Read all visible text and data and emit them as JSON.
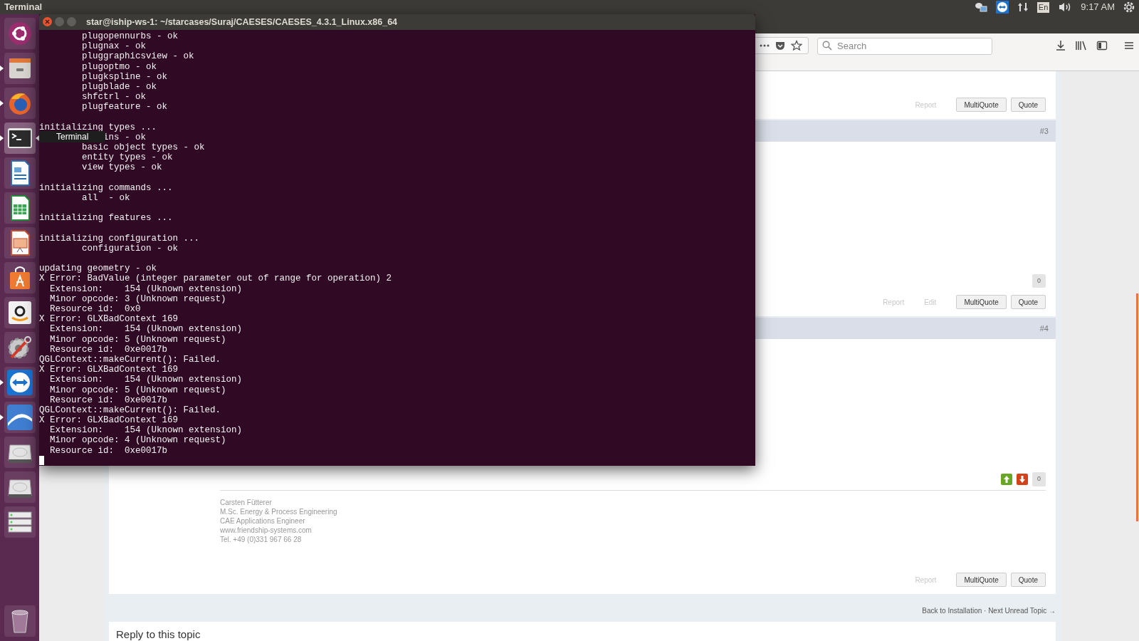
{
  "top_bar": {
    "app_name": "Terminal",
    "keyboard_layout": "En",
    "clock": "9:17 AM"
  },
  "launcher": {
    "items": [
      {
        "kind": "ubuntu",
        "running": false,
        "focused": false
      },
      {
        "kind": "files",
        "running": true,
        "focused": false
      },
      {
        "kind": "firefox",
        "running": true,
        "focused": false
      },
      {
        "kind": "terminal",
        "running": true,
        "focused": true
      },
      {
        "kind": "writer",
        "running": false,
        "focused": false
      },
      {
        "kind": "calc",
        "running": false,
        "focused": false
      },
      {
        "kind": "impress",
        "running": false,
        "focused": false
      },
      {
        "kind": "software",
        "running": false,
        "focused": false
      },
      {
        "kind": "amazon",
        "running": false,
        "focused": false
      },
      {
        "kind": "settings",
        "running": false,
        "focused": false
      },
      {
        "kind": "teamviewer",
        "running": true,
        "focused": false
      },
      {
        "kind": "arc",
        "running": true,
        "focused": false
      },
      {
        "kind": "drive",
        "running": false,
        "focused": false
      },
      {
        "kind": "drive",
        "running": false,
        "focused": false
      },
      {
        "kind": "server",
        "running": false,
        "focused": false
      },
      {
        "kind": "trash",
        "running": false,
        "focused": false
      }
    ],
    "tooltip": "Terminal"
  },
  "browser": {
    "search": {
      "placeholder": "Search"
    },
    "posts": [
      {
        "footer": {
          "actions": [
            "Report"
          ],
          "buttons": [
            "MultiQuote",
            "Quote"
          ]
        }
      },
      {
        "number": "#3",
        "reputation": "0",
        "footer": {
          "actions": [
            "Report",
            "Edit"
          ],
          "buttons": [
            "MultiQuote",
            "Quote"
          ]
        }
      },
      {
        "number": "#4",
        "reputation": "0",
        "votes": true,
        "signature": [
          "Carsten Fütterer",
          "M.Sc. Energy & Process Engineering",
          "CAE Applications Engineer",
          "www.friendship-systems.com",
          "Tel. +49 (0)331 967 66 28"
        ],
        "footer": {
          "actions": [
            "Report"
          ],
          "buttons": [
            "MultiQuote",
            "Quote"
          ]
        }
      }
    ],
    "topic_links": "Back to Installation · Next Unread Topic →",
    "reply_title": "Reply to this topic"
  },
  "terminal": {
    "title": "star@iship-ws-1: ~/starcases/Suraj/CAESES/CAESES_4.3.1_Linux.x86_64",
    "lines": [
      {
        "kind": "sub",
        "text": "plugopennurbs - ok"
      },
      {
        "kind": "sub",
        "text": "plugnax - ok"
      },
      {
        "kind": "sub",
        "text": "pluggraphicsview - ok"
      },
      {
        "kind": "sub",
        "text": "plugoptmo - ok"
      },
      {
        "kind": "sub",
        "text": "plugkspline - ok"
      },
      {
        "kind": "sub",
        "text": "plugblade - ok"
      },
      {
        "kind": "sub",
        "text": "shfctrl - ok"
      },
      {
        "kind": "sub",
        "text": "plugfeature - ok"
      },
      {
        "kind": "blank"
      },
      {
        "kind": "top",
        "text": "initializing types ..."
      },
      {
        "kind": "tail",
        "text": "ins - ok"
      },
      {
        "kind": "sub",
        "text": "basic object types - ok"
      },
      {
        "kind": "sub",
        "text": "entity types - ok"
      },
      {
        "kind": "sub",
        "text": "view types - ok"
      },
      {
        "kind": "blank"
      },
      {
        "kind": "top",
        "text": "initializing commands ..."
      },
      {
        "kind": "sub",
        "text": "all  - ok"
      },
      {
        "kind": "blank"
      },
      {
        "kind": "top",
        "text": "initializing features ..."
      },
      {
        "kind": "blank"
      },
      {
        "kind": "top",
        "text": "initializing configuration ..."
      },
      {
        "kind": "sub",
        "text": "configuration - ok"
      },
      {
        "kind": "blank"
      },
      {
        "kind": "top",
        "text": "updating geometry - ok"
      },
      {
        "kind": "top",
        "text": "X Error: BadValue (integer parameter out of range for operation) 2"
      },
      {
        "kind": "detail",
        "text": "Extension:    154 (Uknown extension)"
      },
      {
        "kind": "detail",
        "text": "Minor opcode: 3 (Unknown request)"
      },
      {
        "kind": "detail",
        "text": "Resource id:  0x0"
      },
      {
        "kind": "top",
        "text": "X Error: GLXBadContext 169"
      },
      {
        "kind": "detail",
        "text": "Extension:    154 (Uknown extension)"
      },
      {
        "kind": "detail",
        "text": "Minor opcode: 5 (Unknown request)"
      },
      {
        "kind": "detail",
        "text": "Resource id:  0xe0017b"
      },
      {
        "kind": "top",
        "text": "QGLContext::makeCurrent(): Failed."
      },
      {
        "kind": "top",
        "text": "X Error: GLXBadContext 169"
      },
      {
        "kind": "detail",
        "text": "Extension:    154 (Uknown extension)"
      },
      {
        "kind": "detail",
        "text": "Minor opcode: 5 (Unknown request)"
      },
      {
        "kind": "detail",
        "text": "Resource id:  0xe0017b"
      },
      {
        "kind": "top",
        "text": "QGLContext::makeCurrent(): Failed."
      },
      {
        "kind": "top",
        "text": "X Error: GLXBadContext 169"
      },
      {
        "kind": "detail",
        "text": "Extension:    154 (Uknown extension)"
      },
      {
        "kind": "detail",
        "text": "Minor opcode: 4 (Unknown request)"
      },
      {
        "kind": "detail",
        "text": "Resource id:  0xe0017b"
      },
      {
        "kind": "cursor"
      }
    ]
  }
}
